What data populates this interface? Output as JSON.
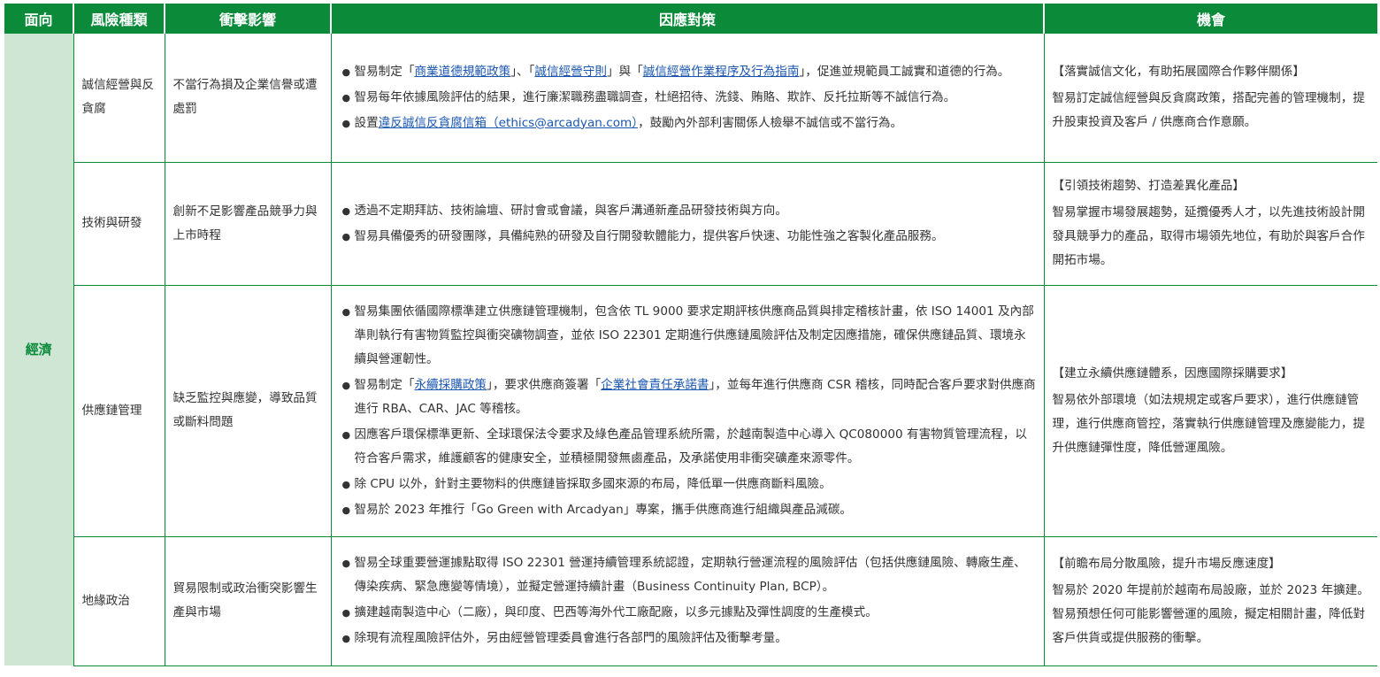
{
  "headers": {
    "aspect": "面向",
    "risk_type": "風險種類",
    "impact": "衝擊影響",
    "measures": "因應對策",
    "opportunity": "機會"
  },
  "aspect": "經濟",
  "rows": [
    {
      "risk_type": "誠信經營與反貪腐",
      "impact": "不當行為損及企業信譽或遭處罰",
      "measures": [
        [
          {
            "t": "智易制定「"
          },
          {
            "t": "商業道德規範政策",
            "link": true
          },
          {
            "t": "」、「"
          },
          {
            "t": "誠信經營守則",
            "link": true
          },
          {
            "t": "」與「"
          },
          {
            "t": "誠信經營作業程序及行為指南",
            "link": true
          },
          {
            "t": "」，促進並規範員工誠實和道德的行為。"
          }
        ],
        [
          {
            "t": "智易每年依據風險評估的結果，進行廉潔職務盡職調查，杜絕招待、洗錢、賄賂、欺詐、反托拉斯等不誠信行為。"
          }
        ],
        [
          {
            "t": "設置"
          },
          {
            "t": "違反誠信反貪腐信箱（ethics@arcadyan.com）",
            "link": true
          },
          {
            "t": "，鼓勵內外部利害關係人檢舉不誠信或不當行為。"
          }
        ]
      ],
      "opportunity_title": "【落實誠信文化，有助拓展國際合作夥伴關係】",
      "opportunity_body": "智易訂定誠信經營與反貪腐政策，搭配完善的管理機制，提升股東投資及客戶 / 供應商合作意願。"
    },
    {
      "risk_type": "技術與研發",
      "impact": "創新不足影響產品競爭力與上市時程",
      "measures": [
        [
          {
            "t": "透過不定期拜訪、技術論壇、研討會或會議，與客戶溝通新產品研發技術與方向。"
          }
        ],
        [
          {
            "t": "智易具備優秀的研發團隊，具備純熟的研發及自行開發軟體能力，提供客戶快速、功能性強之客製化產品服務。"
          }
        ]
      ],
      "opportunity_title": "【引領技術趨勢、打造差異化產品】",
      "opportunity_body": "智易掌握市場發展趨勢，延攬優秀人才，以先進技術設計開發具競爭力的產品，取得市場領先地位，有助於與客戶合作開拓市場。"
    },
    {
      "risk_type": "供應鏈管理",
      "impact": "缺乏監控與應變，導致品質或斷料問題",
      "measures": [
        [
          {
            "t": "智易集團依循國際標準建立供應鏈管理機制，包含依 TL 9000 要求定期評核供應商品質與排定稽核計畫，依 ISO 14001 及內部準則執行有害物質監控與衝突礦物調查，並依 ISO 22301 定期進行供應鏈風險評估及制定因應措施，確保供應鏈品質、環境永續與營運韌性。"
          }
        ],
        [
          {
            "t": "智易制定「"
          },
          {
            "t": "永續採購政策",
            "link": true
          },
          {
            "t": "」，要求供應商簽署「"
          },
          {
            "t": "企業社會責任承諾書",
            "link": true
          },
          {
            "t": "」，並每年進行供應商 CSR 稽核，同時配合客戶要求對供應商進行 RBA、CAR、JAC 等稽核。"
          }
        ],
        [
          {
            "t": "因應客戶環保標準更新、全球環保法令要求及綠色產品管理系統所需，於越南製造中心導入 QC080000 有害物質管理流程，以符合客戶需求，維護顧客的健康安全，並積極開發無鹵產品，及承諾使用非衝突礦產來源零件。"
          }
        ],
        [
          {
            "t": "除 CPU 以外，針對主要物料的供應鏈皆採取多國來源的布局，降低單一供應商斷料風險。"
          }
        ],
        [
          {
            "t": "智易於 2023 年推行「Go Green with Arcadyan」專案，攜手供應商進行組織與產品減碳。"
          }
        ]
      ],
      "opportunity_title": "【建立永續供應鏈體系，因應國際採購要求】",
      "opportunity_body": "智易依外部環境（如法規規定或客戶要求），進行供應鏈管理，進行供應商管控，落實執行供應鏈管理及應變能力，提升供應鏈彈性度，降低營運風險。"
    },
    {
      "risk_type": "地緣政治",
      "impact": "貿易限制或政治衝突影響生產與市場",
      "measures": [
        [
          {
            "t": "智易全球重要營運據點取得 ISO 22301 營運持續管理系統認證，定期執行營運流程的風險評估（包括供應鏈風險、轉廠生產、傳染疾病、緊急應變等情境），並擬定營運持續計畫（Business Continuity Plan, BCP）。"
          }
        ],
        [
          {
            "t": "擴建越南製造中心（二廠），與印度、巴西等海外代工廠配廠，以多元據點及彈性調度的生產模式。"
          }
        ],
        [
          {
            "t": "除現有流程風險評估外，另由經營管理委員會進行各部門的風險評估及衝擊考量。"
          }
        ]
      ],
      "opportunity_title": "【前瞻布局分散風險，提升市場反應速度】",
      "opportunity_body": "智易於 2020 年提前於越南布局設廠，並於 2023 年擴建。智易預想任何可能影響營運的風險，擬定相關計畫，降低對客戶供貨或提供服務的衝擊。"
    }
  ],
  "bullet_glyph": "●",
  "colors": {
    "header_green": "#0b8a3a",
    "aspect_bg": "#cfe6d5",
    "link_blue": "#1a56b0"
  }
}
